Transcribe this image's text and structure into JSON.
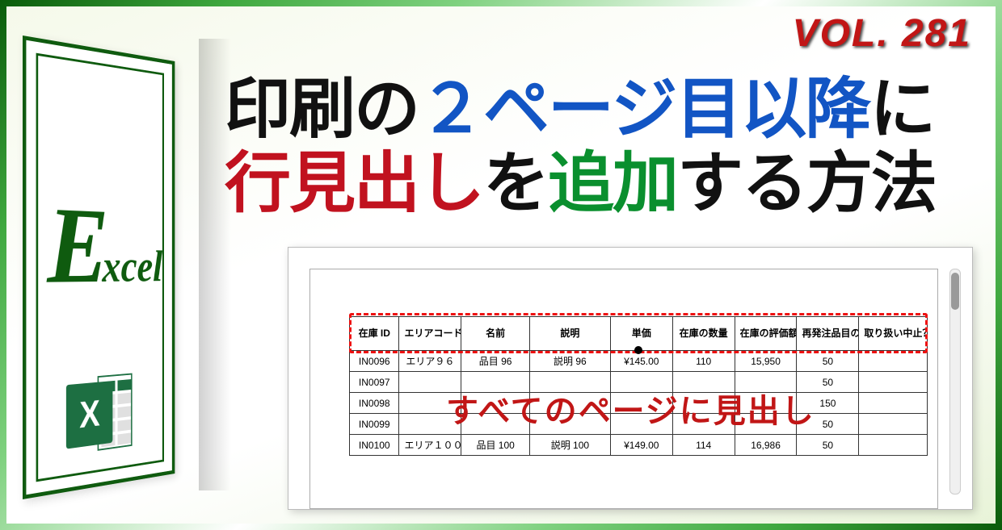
{
  "vol_label": "VOL. 281",
  "logo": {
    "big_e": "E",
    "xcel": "xcel",
    "icon_x": "X"
  },
  "title": {
    "line1": {
      "s1": "印刷の",
      "s2": "２ページ目以降",
      "s3": "に"
    },
    "line2": {
      "s1": "行見出し",
      "s2": "を",
      "s3": "追加",
      "s4": "する方法"
    }
  },
  "overlay_text": "すべてのページに見出し",
  "table": {
    "headers": [
      "在庫 ID",
      "エリアコード",
      "名前",
      "説明",
      "単価",
      "在庫の数量",
      "在庫の評価額",
      "再発注品目の数量",
      "取り扱い中止？"
    ],
    "rows": [
      [
        "IN0096",
        "エリア９６",
        "品目 96",
        "説明 96",
        "¥145.00",
        "110",
        "15,950",
        "50",
        ""
      ],
      [
        "IN0097",
        "",
        "",
        "",
        "",
        "",
        "",
        "50",
        ""
      ],
      [
        "IN0098",
        "",
        "",
        "",
        "",
        "",
        "",
        "150",
        ""
      ],
      [
        "IN0099",
        "",
        "",
        "",
        "",
        "",
        "",
        "50",
        ""
      ],
      [
        "IN0100",
        "エリア１００",
        "品目 100",
        "説明 100",
        "¥149.00",
        "114",
        "16,986",
        "50",
        ""
      ]
    ]
  }
}
